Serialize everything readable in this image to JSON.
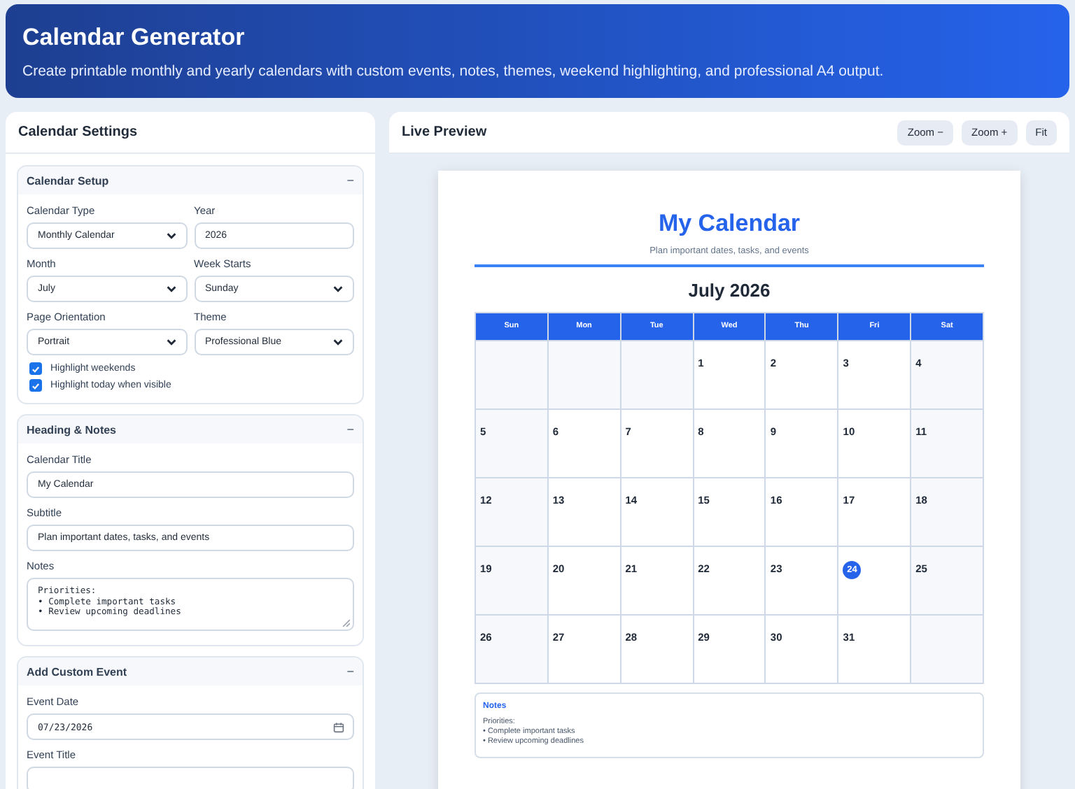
{
  "header": {
    "title": "Calendar Generator",
    "subtitle": "Create printable monthly and yearly calendars with custom events, notes, themes, weekend highlighting, and professional A4 output."
  },
  "settings": {
    "title": "Calendar Settings",
    "sections": [
      {
        "title": "Calendar Setup",
        "toggle": "−",
        "kind": "pairs",
        "fields": [
          {
            "kind": "select",
            "label": "Calendar Type",
            "value": "Monthly Calendar"
          },
          {
            "kind": "input",
            "label": "Year",
            "value": "2026"
          },
          {
            "kind": "select",
            "label": "Month",
            "value": "July"
          },
          {
            "kind": "select",
            "label": "Week Starts",
            "value": "Sunday"
          },
          {
            "kind": "select",
            "label": "Page Orientation",
            "value": "Portrait"
          },
          {
            "kind": "select",
            "label": "Theme",
            "value": "Professional Blue"
          }
        ],
        "checkboxes": [
          {
            "label": "Highlight weekends",
            "checked": true
          },
          {
            "label": "Highlight today when visible",
            "checked": true
          }
        ]
      },
      {
        "title": "Heading & Notes",
        "toggle": "−",
        "kind": "stack",
        "fields": [
          {
            "kind": "input",
            "label": "Calendar Title",
            "value": "My Calendar"
          },
          {
            "kind": "input",
            "label": "Subtitle",
            "value": "Plan important dates, tasks, and events"
          },
          {
            "kind": "textarea",
            "label": "Notes",
            "value": "Priorities:\n• Complete important tasks\n• Review upcoming deadlines"
          }
        ]
      },
      {
        "title": "Add Custom Event",
        "toggle": "−",
        "kind": "stack",
        "fields": [
          {
            "kind": "date",
            "label": "Event Date",
            "value": "07/23/2026"
          },
          {
            "kind": "input",
            "label": "Event Title"
          }
        ]
      }
    ]
  },
  "preview": {
    "title": "Live Preview",
    "buttons": [
      "Zoom −",
      "Zoom +",
      "Fit"
    ],
    "calendar": {
      "title": "My Calendar",
      "subtitle": "Plan important dates, tasks, and events",
      "month": "July 2026",
      "weekdays": [
        "Sun",
        "Mon",
        "Tue",
        "Wed",
        "Thu",
        "Fri",
        "Sat"
      ],
      "cells": [
        {
          "kind": "blank"
        },
        {
          "kind": "blank"
        },
        {
          "kind": "blank"
        },
        {
          "kind": "day",
          "day": "1",
          "weekend": false,
          "today": false
        },
        {
          "kind": "day",
          "day": "2",
          "weekend": false,
          "today": false
        },
        {
          "kind": "day",
          "day": "3",
          "weekend": false,
          "today": false
        },
        {
          "kind": "day",
          "day": "4",
          "weekend": true,
          "today": false
        },
        {
          "kind": "day",
          "day": "5",
          "weekend": true,
          "today": false
        },
        {
          "kind": "day",
          "day": "6",
          "weekend": false,
          "today": false
        },
        {
          "kind": "day",
          "day": "7",
          "weekend": false,
          "today": false
        },
        {
          "kind": "day",
          "day": "8",
          "weekend": false,
          "today": false
        },
        {
          "kind": "day",
          "day": "9",
          "weekend": false,
          "today": false
        },
        {
          "kind": "day",
          "day": "10",
          "weekend": false,
          "today": false
        },
        {
          "kind": "day",
          "day": "11",
          "weekend": true,
          "today": false
        },
        {
          "kind": "day",
          "day": "12",
          "weekend": true,
          "today": false
        },
        {
          "kind": "day",
          "day": "13",
          "weekend": false,
          "today": false
        },
        {
          "kind": "day",
          "day": "14",
          "weekend": false,
          "today": false
        },
        {
          "kind": "day",
          "day": "15",
          "weekend": false,
          "today": false
        },
        {
          "kind": "day",
          "day": "16",
          "weekend": false,
          "today": false
        },
        {
          "kind": "day",
          "day": "17",
          "weekend": false,
          "today": false
        },
        {
          "kind": "day",
          "day": "18",
          "weekend": true,
          "today": false
        },
        {
          "kind": "day",
          "day": "19",
          "weekend": true,
          "today": false
        },
        {
          "kind": "day",
          "day": "20",
          "weekend": false,
          "today": false
        },
        {
          "kind": "day",
          "day": "21",
          "weekend": false,
          "today": false
        },
        {
          "kind": "day",
          "day": "22",
          "weekend": false,
          "today": false
        },
        {
          "kind": "day",
          "day": "23",
          "weekend": false,
          "today": false
        },
        {
          "kind": "day",
          "day": "24",
          "weekend": false,
          "today": true
        },
        {
          "kind": "day",
          "day": "25",
          "weekend": true,
          "today": false
        },
        {
          "kind": "day",
          "day": "26",
          "weekend": true,
          "today": false
        },
        {
          "kind": "day",
          "day": "27",
          "weekend": false,
          "today": false
        },
        {
          "kind": "day",
          "day": "28",
          "weekend": false,
          "today": false
        },
        {
          "kind": "day",
          "day": "29",
          "weekend": false,
          "today": false
        },
        {
          "kind": "day",
          "day": "30",
          "weekend": false,
          "today": false
        },
        {
          "kind": "day",
          "day": "31",
          "weekend": false,
          "today": false
        },
        {
          "kind": "blank"
        }
      ],
      "notes": {
        "title": "Notes",
        "text": "Priorities:\n• Complete important tasks\n• Review upcoming deadlines"
      }
    }
  }
}
